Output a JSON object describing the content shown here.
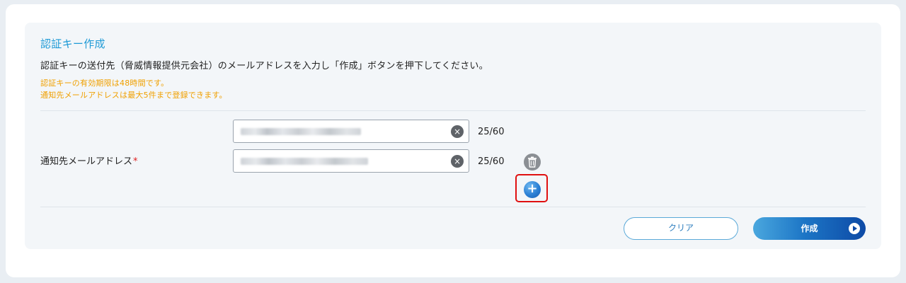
{
  "section": {
    "title": "認証キー作成",
    "description": "認証キーの送付先（脅威情報提供元会社）のメールアドレスを入力し「作成」ボタンを押下してください。",
    "notes": [
      "認証キーの有効期限は48時間です。",
      "通知先メールアドレスは最大5件まで登録できます。"
    ]
  },
  "form": {
    "label": "通知先メールアドレス",
    "required_mark": "*",
    "emails": [
      {
        "char_count": "25/60"
      },
      {
        "char_count": "25/60"
      }
    ],
    "clear_icon_glyph": "×",
    "add_icon_glyph": "+"
  },
  "actions": {
    "clear_label": "クリア",
    "create_label": "作成"
  },
  "colors": {
    "accent": "#1e9ad6",
    "warning_text": "#f0a000",
    "required": "#e02020",
    "highlight": "#e01010"
  }
}
